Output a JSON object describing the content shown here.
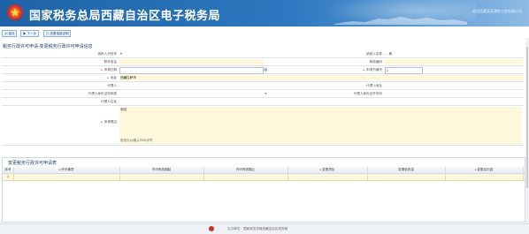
{
  "header": {
    "title": "国家税务总局西藏自治区电子税务局",
    "user_info": "欢迎西藏某某建筑工程有限公司"
  },
  "toolbar": {
    "save_label": "保存",
    "next_label": "下一步",
    "view_label": "查看填报说明"
  },
  "form": {
    "section_title": "税务行政许可申请-变更税务行政许可申请信息",
    "fields": {
      "taxpayer_id_label": "纳税人识别号",
      "taxpayer_id_value": "9",
      "taxpayer_name_label": "纳税人名称",
      "taxpayer_name_value": "…有",
      "contact_phone_label": "联系电话",
      "contact_phone_value": "",
      "postal_code_label": "邮政编码",
      "postal_code_value": "",
      "apply_date_label": "申请日期",
      "apply_date_value": "",
      "doc_number_label": "申请书编号",
      "doc_number_value": "1",
      "address_label": "地址",
      "address_value": "西藏拉萨市",
      "agent_label": "代理人",
      "agent_value": "",
      "agent_address_label": "代理人地址",
      "agent_address_value": "",
      "agent_id_type_label": "代理人身份证件种类",
      "agent_id_type_value": "",
      "agent_id_no_label": "代理人身份证件号码",
      "agent_id_no_value": "",
      "agent_addr2_label": "代理人住址",
      "agent_addr2_value": "",
      "reason_label": "申请理由",
      "reason_value": "测试",
      "reason_hint": "您还可以输入2994字符"
    }
  },
  "grid": {
    "title": "变更税务行政许可申请表",
    "columns": [
      "序号",
      "许可事项",
      "许可有效期起",
      "许可有效期止",
      "变更项目",
      "变更前内容",
      "变更后内容"
    ],
    "required_cols": [
      false,
      true,
      false,
      false,
      true,
      false,
      true
    ],
    "rows": [
      {
        "index": "1"
      }
    ]
  },
  "footer": {
    "text": "主办单位：国家税务总局西藏自治区税务局"
  },
  "colors": {
    "header_blue": "#2d78c0",
    "highlight_yellow": "#fdf8dc",
    "required_red": "#d02020"
  }
}
